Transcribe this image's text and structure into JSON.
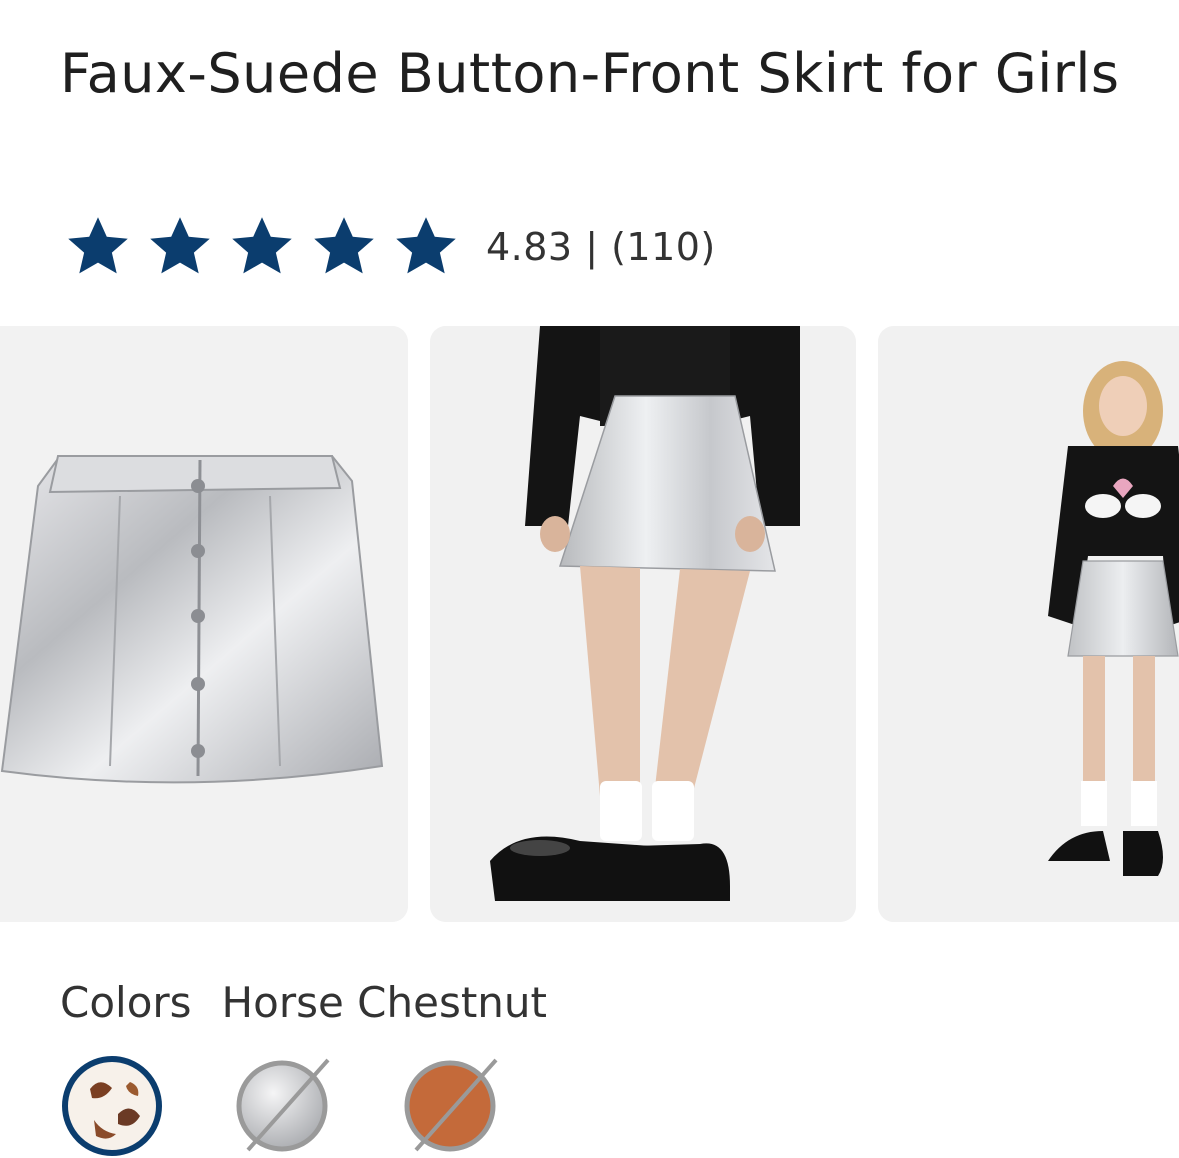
{
  "product": {
    "title": "Faux-Suede Button-Front Skirt for Girls",
    "rating_value": "4.83",
    "rating_count": "(110)",
    "rating_text": "4.83 | (110)",
    "stars": 5,
    "star_color": "#0b3d6e"
  },
  "gallery": {
    "images": [
      {
        "icon": "skirt-flat-lay-image"
      },
      {
        "icon": "skirt-back-view-image"
      },
      {
        "icon": "skirt-model-full-view-image"
      }
    ]
  },
  "colors": {
    "label": "Colors",
    "selected": "Horse Chestnut",
    "swatches": [
      {
        "name": "horse-chestnut",
        "available": true,
        "selected": true,
        "ring_color": "#0b3d6e"
      },
      {
        "name": "silver",
        "available": false,
        "selected": false,
        "fill": "#c9c9c9"
      },
      {
        "name": "brown",
        "available": false,
        "selected": false,
        "fill": "#c46a3a"
      }
    ]
  }
}
